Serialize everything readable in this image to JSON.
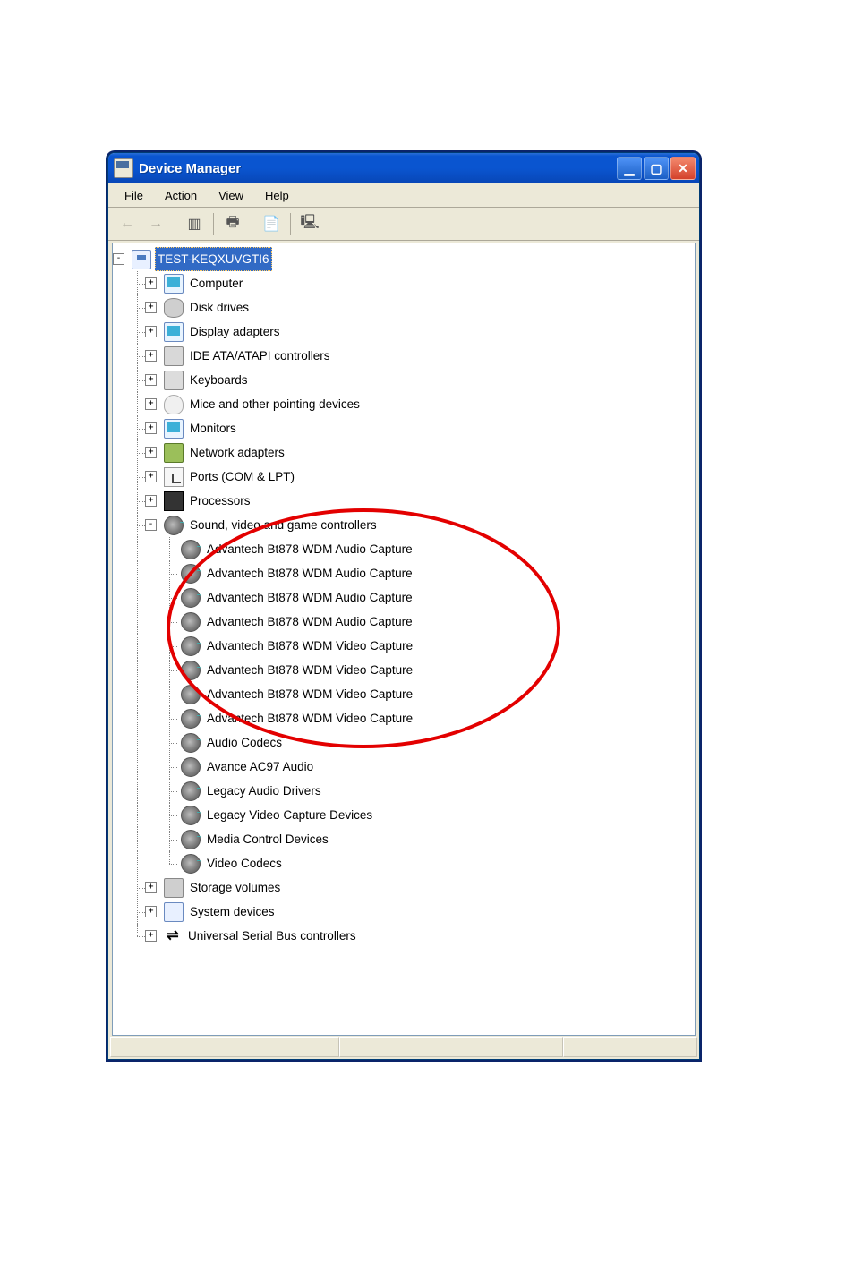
{
  "window": {
    "title": "Device Manager"
  },
  "menubar": {
    "items": [
      "File",
      "Action",
      "View",
      "Help"
    ]
  },
  "tree": {
    "root": {
      "label": "TEST-KEQXUVGTI6",
      "icon": "computer",
      "expanded": true,
      "selected": true
    },
    "categories": [
      {
        "label": "Computer",
        "icon": "monitor",
        "expanded": false
      },
      {
        "label": "Disk drives",
        "icon": "disk",
        "expanded": false
      },
      {
        "label": "Display adapters",
        "icon": "monitor",
        "expanded": false
      },
      {
        "label": "IDE ATA/ATAPI controllers",
        "icon": "ide",
        "expanded": false
      },
      {
        "label": "Keyboards",
        "icon": "keyboard",
        "expanded": false
      },
      {
        "label": "Mice and other pointing devices",
        "icon": "mouse",
        "expanded": false
      },
      {
        "label": "Monitors",
        "icon": "monitor",
        "expanded": false
      },
      {
        "label": "Network adapters",
        "icon": "network",
        "expanded": false
      },
      {
        "label": "Ports (COM & LPT)",
        "icon": "ports",
        "expanded": false
      },
      {
        "label": "Processors",
        "icon": "cpu",
        "expanded": false
      },
      {
        "label": "Sound, video and game controllers",
        "icon": "sound",
        "expanded": true,
        "children": [
          {
            "label": "Advantech Bt878 WDM Audio Capture",
            "icon": "sound"
          },
          {
            "label": "Advantech Bt878 WDM Audio Capture",
            "icon": "sound"
          },
          {
            "label": "Advantech Bt878 WDM Audio Capture",
            "icon": "sound"
          },
          {
            "label": "Advantech Bt878 WDM Audio Capture",
            "icon": "sound"
          },
          {
            "label": "Advantech Bt878 WDM Video Capture",
            "icon": "sound"
          },
          {
            "label": "Advantech Bt878 WDM Video Capture",
            "icon": "sound"
          },
          {
            "label": "Advantech Bt878 WDM Video Capture",
            "icon": "sound"
          },
          {
            "label": "Advantech Bt878 WDM Video Capture",
            "icon": "sound"
          },
          {
            "label": "Audio Codecs",
            "icon": "sound"
          },
          {
            "label": "Avance AC97 Audio",
            "icon": "sound"
          },
          {
            "label": "Legacy Audio Drivers",
            "icon": "sound"
          },
          {
            "label": "Legacy Video Capture Devices",
            "icon": "sound"
          },
          {
            "label": "Media Control Devices",
            "icon": "sound"
          },
          {
            "label": "Video Codecs",
            "icon": "sound"
          }
        ]
      },
      {
        "label": "Storage volumes",
        "icon": "storage",
        "expanded": false
      },
      {
        "label": "System devices",
        "icon": "system",
        "expanded": false
      },
      {
        "label": "Universal Serial Bus controllers",
        "icon": "usb",
        "expanded": false
      }
    ]
  },
  "annotation": {
    "type": "ellipse",
    "color": "#e30000"
  }
}
